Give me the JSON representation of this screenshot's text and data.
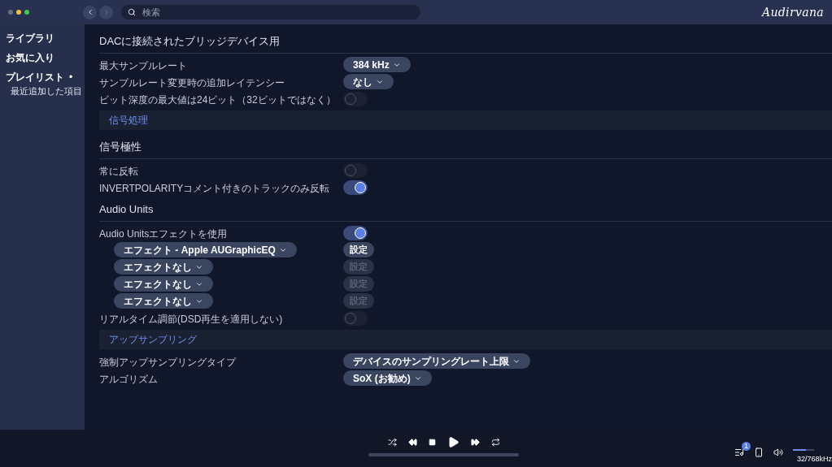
{
  "search": {
    "placeholder": "検索"
  },
  "logo": "Audirvana",
  "sidebar": {
    "items": [
      {
        "label": "ライブラリ"
      },
      {
        "label": "お気に入り"
      },
      {
        "label": "プレイリスト",
        "marker": "•",
        "children": [
          {
            "label": "最近追加した項目"
          }
        ]
      }
    ]
  },
  "content": [
    {
      "kind": "heading",
      "label": "DACに接続されたブリッジデバイス用"
    },
    {
      "kind": "select",
      "label": "最大サンプルレート",
      "value": "384 kHz"
    },
    {
      "kind": "select",
      "label": "サンプルレート変更時の追加レイテンシー",
      "value": "なし"
    },
    {
      "kind": "toggle",
      "label": "ビット深度の最大値は24ビット（32ビットではなく）",
      "on": false
    },
    {
      "kind": "band",
      "label": "信号処理"
    },
    {
      "kind": "heading",
      "label": "信号極性"
    },
    {
      "kind": "toggle",
      "label": "常に反転",
      "on": false
    },
    {
      "kind": "toggle",
      "label": "INVERTPOLARITYコメント付きのトラックのみ反転",
      "on": true
    },
    {
      "kind": "heading",
      "label": "Audio Units"
    },
    {
      "kind": "toggle",
      "label": "Audio Unitsエフェクトを使用",
      "on": true
    },
    {
      "kind": "effect",
      "value": "エフェクト - Apple AUGraphicEQ",
      "button": "設定",
      "disabled": false
    },
    {
      "kind": "effect",
      "value": "エフェクトなし",
      "button": "設定",
      "disabled": true
    },
    {
      "kind": "effect",
      "value": "エフェクトなし",
      "button": "設定",
      "disabled": true
    },
    {
      "kind": "effect",
      "value": "エフェクトなし",
      "button": "設定",
      "disabled": true
    },
    {
      "kind": "toggle",
      "label": "リアルタイム調節(DSD再生を適用しない)",
      "on": false
    },
    {
      "kind": "band",
      "label": "アップサンプリング"
    },
    {
      "kind": "select",
      "label": "強制アップサンプリングタイプ",
      "value": "デバイスのサンプリングレート上限"
    },
    {
      "kind": "select",
      "label": "アルゴリズム",
      "value": "SoX (お勧め)"
    }
  ],
  "player": {
    "queue_badge": "1",
    "volume": {
      "level": 0.6
    },
    "format": "32/768kHz"
  }
}
